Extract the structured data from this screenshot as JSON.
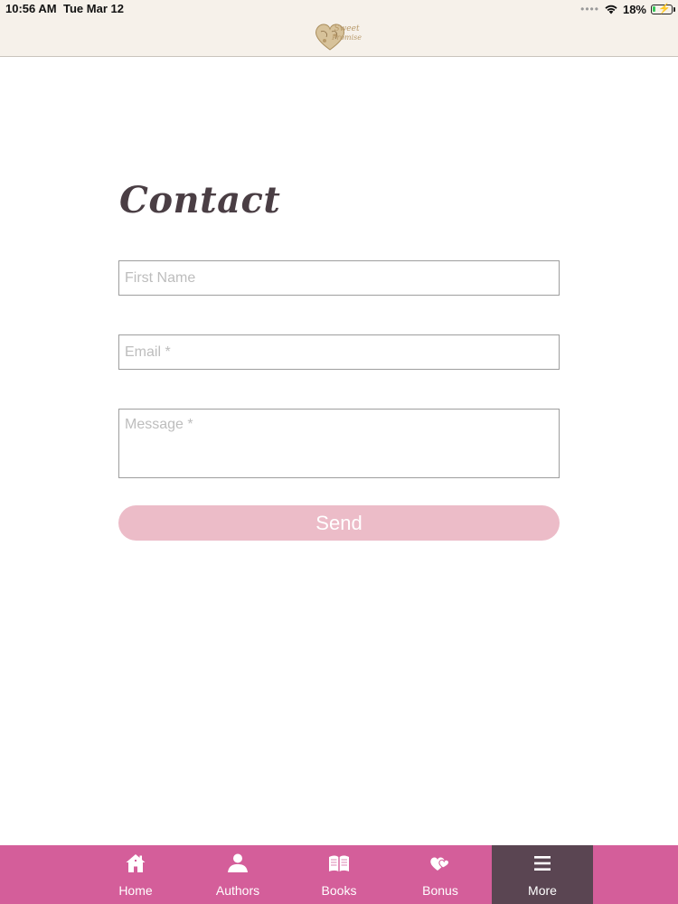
{
  "status_bar": {
    "time": "10:56 AM",
    "date": "Tue Mar 12",
    "signal_dots": "••••",
    "battery_percent": "18%",
    "battery_level": 0.18,
    "icons": [
      "wifi-icon",
      "battery-charging-icon"
    ]
  },
  "header": {
    "logo_line1": "Sweet",
    "logo_line2": "Promise",
    "logo_icon": "heart-logo-icon"
  },
  "main": {
    "title": "Contact",
    "first_name_placeholder": "First Name",
    "first_name_value": "",
    "email_placeholder": "Email *",
    "email_value": "",
    "message_placeholder": "Message *",
    "message_value": "",
    "send_label": "Send"
  },
  "tabs": [
    {
      "label": "Home",
      "icon": "home-icon"
    },
    {
      "label": "Authors",
      "icon": "person-icon"
    },
    {
      "label": "Books",
      "icon": "book-icon"
    },
    {
      "label": "Bonus",
      "icon": "hearts-icon"
    },
    {
      "label": "More",
      "icon": "menu-icon"
    }
  ],
  "active_tab": "More",
  "colors": {
    "tab_bar": "#d45e9a",
    "tab_active": "#5a4552",
    "send_button": "#ecbcc8",
    "header_bg": "#f6f1ea",
    "title": "#4a3e44"
  }
}
